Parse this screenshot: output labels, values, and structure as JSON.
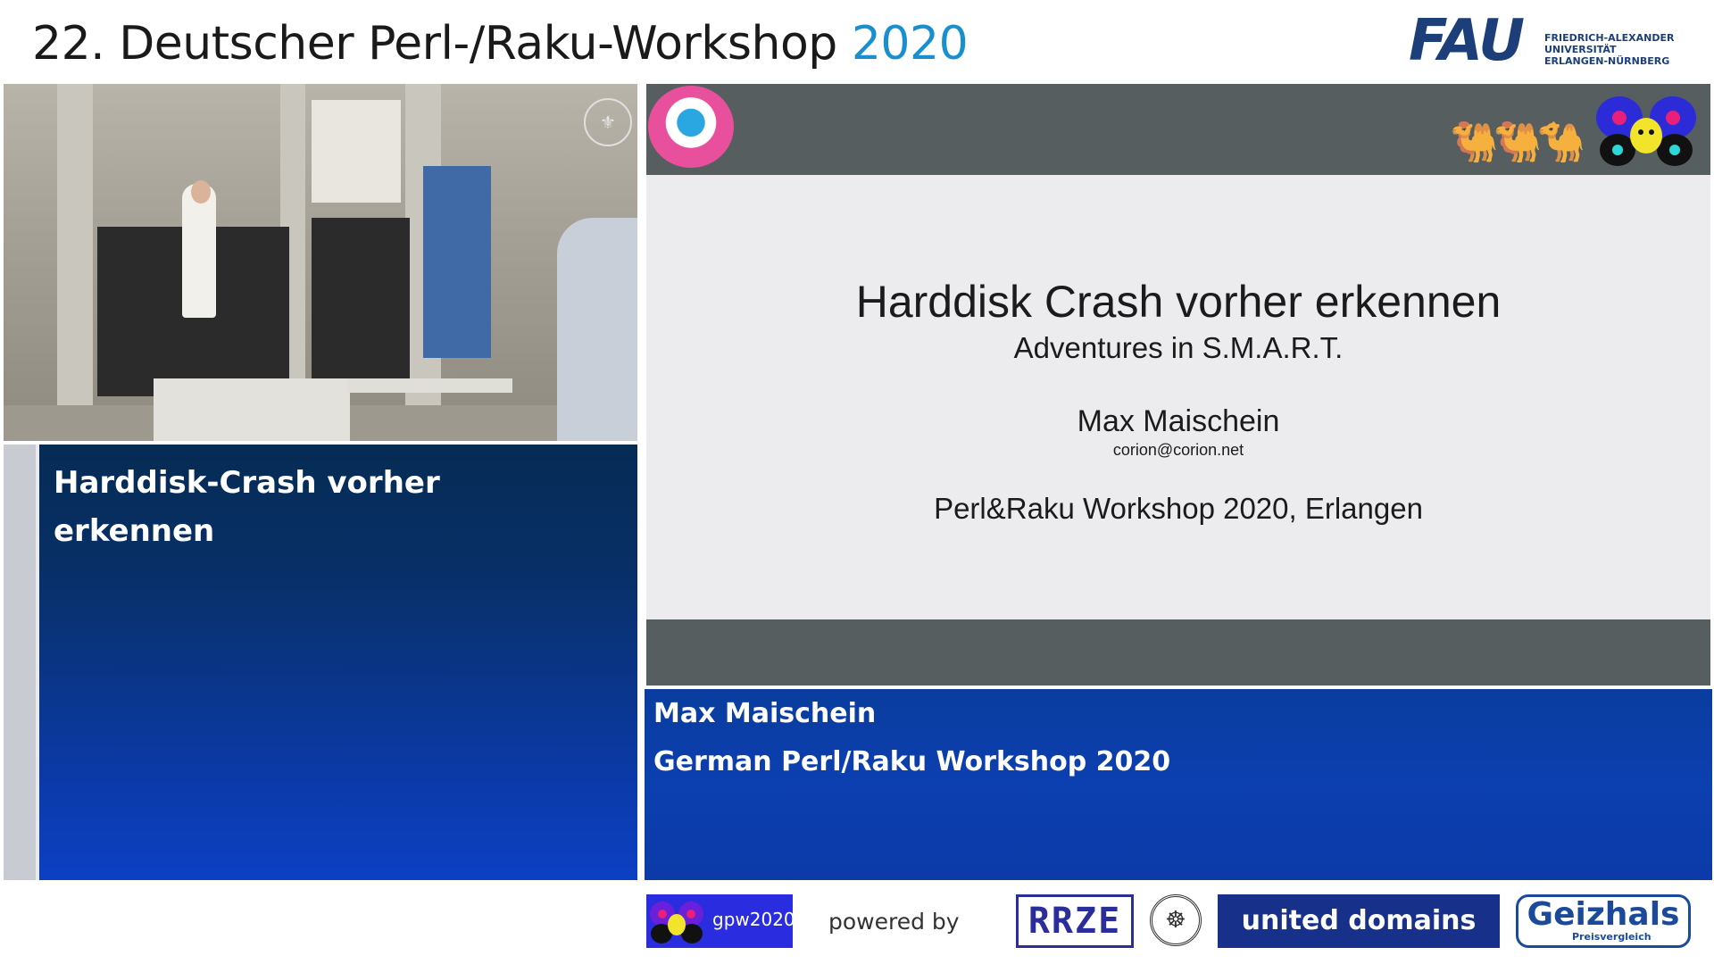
{
  "header": {
    "title_main": "22. Deutscher Perl-/Raku-Workshop",
    "title_year": "2020",
    "logo_text": "FAU",
    "logo_sub": [
      "FRIEDRICH-ALEXANDER",
      "UNIVERSITÄT",
      "ERLANGEN-NÜRNBERG"
    ]
  },
  "left_panel": {
    "talk_title": "Harddisk-Crash vorher erkennen"
  },
  "slide": {
    "title": "Harddisk Crash vorher erkennen",
    "subtitle": "Adventures in S.M.A.R.T.",
    "author": "Max Maischein",
    "email": "corion@corion.net",
    "event": "Perl&Raku Workshop 2020, Erlangen"
  },
  "lower_third": {
    "speaker": "Max Maischein",
    "event": "German Perl/Raku Workshop 2020"
  },
  "footer": {
    "gpw_label": "gpw2020",
    "powered_by": "powered by",
    "rrze_label": "RRZE",
    "ud_label": "united domains",
    "gz_label": "Geizhals",
    "gz_sub": "Preisvergleich"
  },
  "colors": {
    "accent_year": "#1a8fd0",
    "panel_blue": "#0c3fb0",
    "slide_bar": "#575e60",
    "fau_blue": "#1c3f7a"
  },
  "icons": {
    "camera": "presenter-video-feed",
    "slide_logo": "target-circle-icon",
    "slide_camels": "camel-caravan-icon",
    "slide_butterfly": "raku-butterfly-icon"
  }
}
